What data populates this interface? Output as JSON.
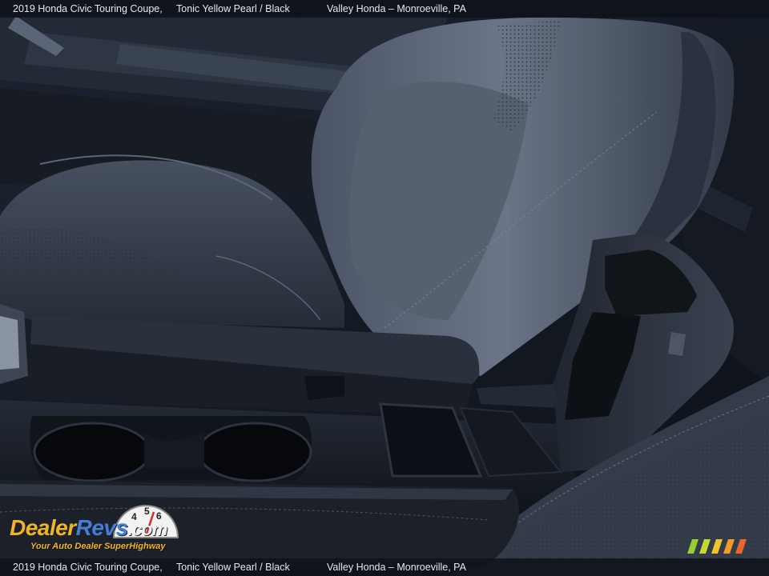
{
  "caption": {
    "title": "2019 Honda Civic Touring Coupe,",
    "color": "Tonic Yellow Pearl / Black",
    "dealer": "Valley Honda – Monroeville, PA"
  },
  "watermark": {
    "brand_part1": "Dealer",
    "brand_part2": "Revs",
    "brand_suffix": ".com",
    "tagline": "Your Auto Dealer SuperHighway",
    "gauge_numbers": [
      "4",
      "5",
      "6"
    ]
  },
  "colors": {
    "leather": "#3c4657",
    "trim": "#151a23",
    "brand_yellow": "#f0b429",
    "brand_blue": "#3f7fd9",
    "stripes": [
      "#9acd32",
      "#c6d631",
      "#f0c330",
      "#f39a2b",
      "#e9672a"
    ]
  },
  "icons": [
    "speedometer-gauge-icon",
    "color-stripes-icon"
  ]
}
